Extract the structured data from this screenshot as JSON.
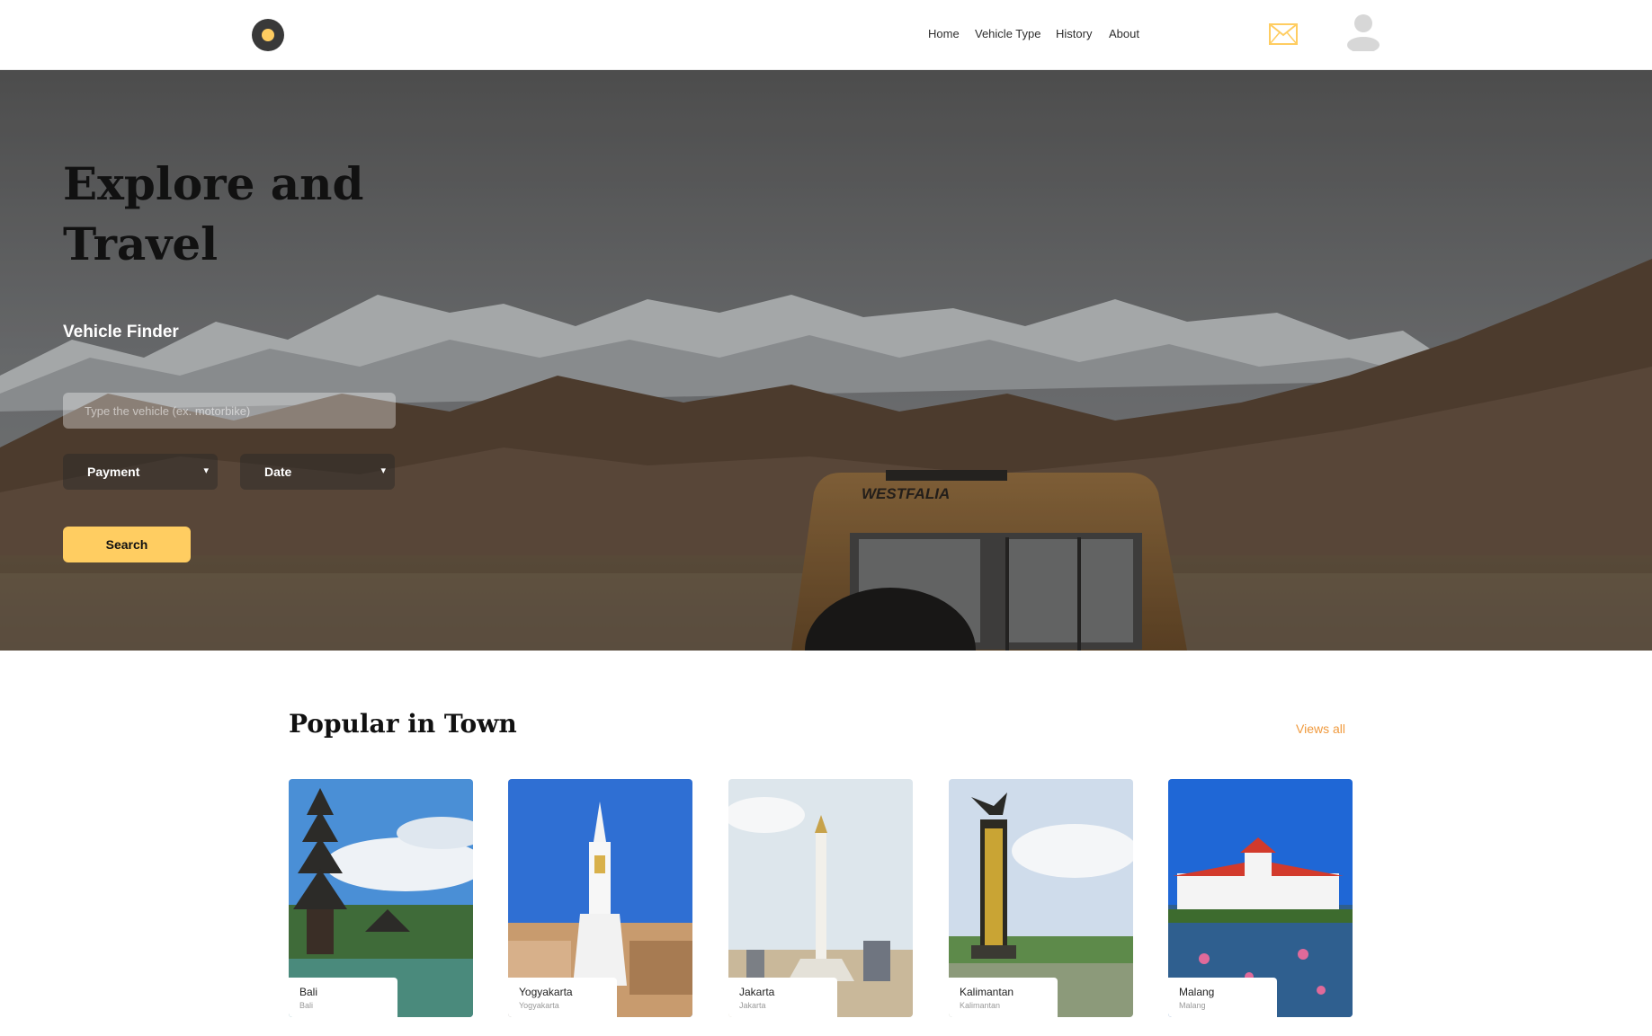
{
  "nav": {
    "links": [
      "Home",
      "Vehicle Type",
      "History",
      "About"
    ]
  },
  "hero": {
    "title_line1": "Explore and",
    "title_line2": "Travel",
    "vehicle_text": "WESTFALIA"
  },
  "finder": {
    "title": "Vehicle Finder",
    "input_placeholder": "Type the vehicle (ex. motorbike)",
    "payment_label": "Payment",
    "date_label": "Date",
    "search_label": "Search"
  },
  "popular": {
    "title": "Popular in Town",
    "views_all": "Views all",
    "cards": [
      {
        "name": "Bali",
        "location": "Bali"
      },
      {
        "name": "Yogyakarta",
        "location": "Yogyakarta"
      },
      {
        "name": "Jakarta",
        "location": "Jakarta"
      },
      {
        "name": "Kalimantan",
        "location": "Kalimantan"
      },
      {
        "name": "Malang",
        "location": "Malang"
      }
    ]
  },
  "colors": {
    "accent": "#ffcd61",
    "link_orange": "#f09a3e",
    "logo_dark": "#393939"
  },
  "icons": [
    "logo-icon",
    "mail-icon",
    "user-avatar-icon",
    "chevron-down-icon"
  ]
}
